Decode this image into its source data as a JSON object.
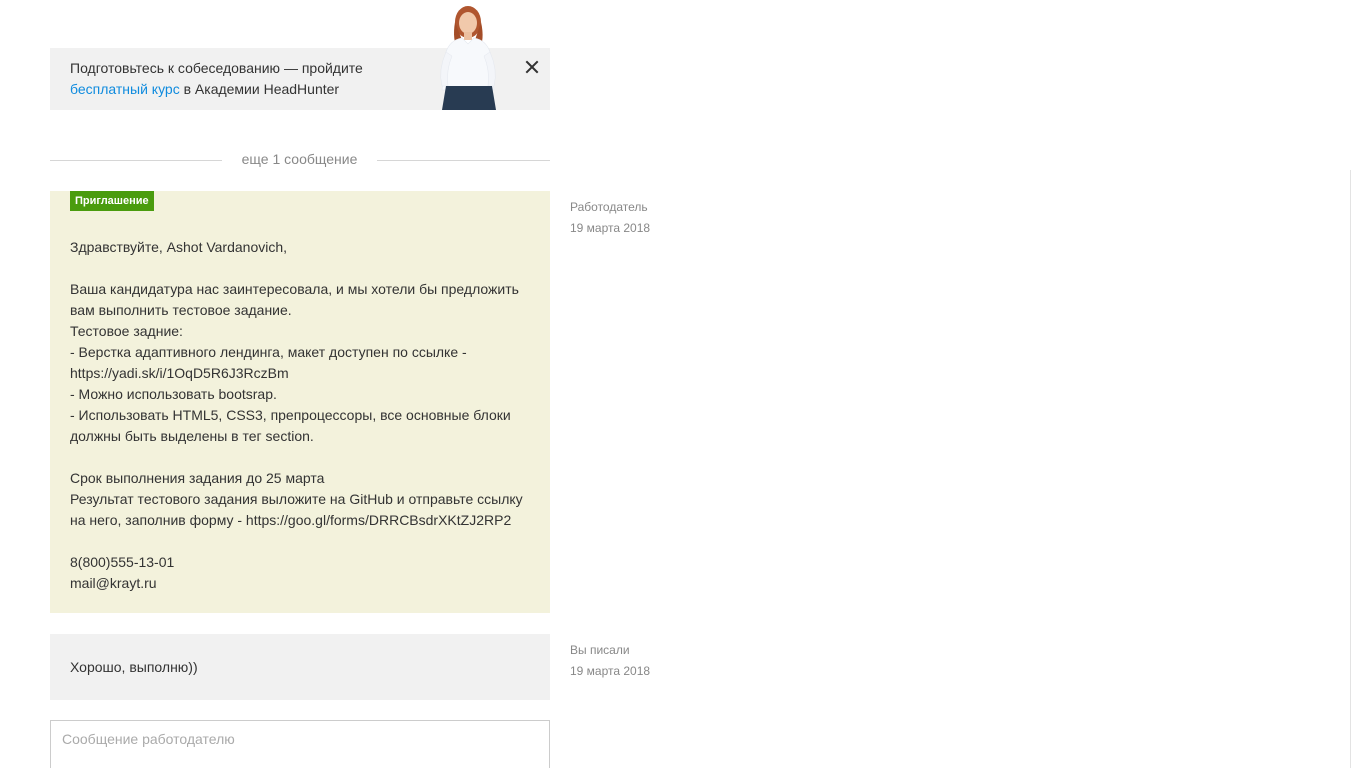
{
  "promo": {
    "text_before": "Подготовьтесь к собеседованию — пройдите",
    "link_text": "бесплатный курс",
    "text_after": " в Академии HeadHunter",
    "photo_icon": "person-photo",
    "close_icon": "close-icon"
  },
  "separator": {
    "label": "еще 1 сообщение"
  },
  "invite_message": {
    "badge": "Приглашение",
    "badge_color": "#4a9c0e",
    "background": "#f3f2dc",
    "lines": {
      "greeting": "Здравствуйте, Ashot Vardanovich,",
      "p1": "Ваша кандидатура нас заинтересовала, и мы хотели бы предложить вам выполнить тестовое задание.",
      "p2": "Тестовое задние:",
      "p3": "- Верстка адаптивного лендинга, макет доступен по ссылке - https://yadi.sk/i/1OqD5R6J3RczBm",
      "p4": "- Можно использовать bootsrap.",
      "p5": "- Использовать HTML5, CSS3, препроцессоры, все основные блоки должны быть выделены в тег section.",
      "p6": "Срок выполнения задания до 25 марта",
      "p7": "Результат тестового задания выложите на GitHub и отправьте ссылку на него, заполнив форму - https://goo.gl/forms/DRRCBsdrXKtZJ2RP2",
      "phone": "8(800)555-13-01",
      "email": "mail@krayt.ru"
    },
    "meta": {
      "author": "Работодатель",
      "date": "19 марта 2018"
    }
  },
  "reply_message": {
    "text": "Хорошо, выполню))",
    "meta": {
      "author": "Вы писали",
      "date": "19 марта 2018"
    }
  },
  "compose": {
    "placeholder": "Сообщение работодателю",
    "value": ""
  }
}
